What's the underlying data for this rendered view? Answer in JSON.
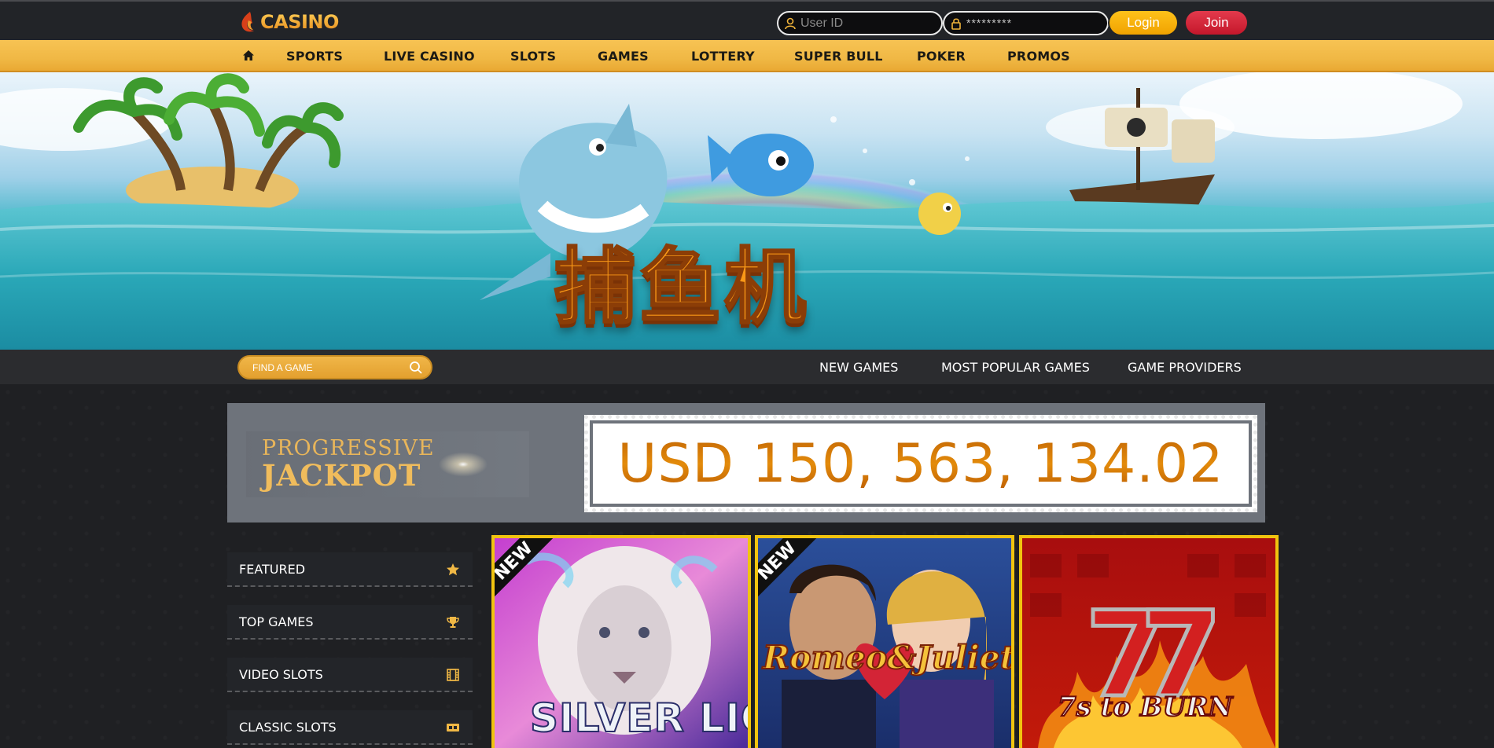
{
  "header": {
    "logo_text": "CASINO",
    "user_id_placeholder": "User ID",
    "password_placeholder": "*********",
    "login_label": "Login",
    "join_label": "Join"
  },
  "nav": {
    "items": [
      "SPORTS",
      "LIVE CASINO",
      "SLOTS",
      "GAMES",
      "LOTTERY",
      "SUPER BULL",
      "POKER",
      "PROMOS"
    ]
  },
  "banner": {
    "title": "捕鱼机"
  },
  "search": {
    "placeholder": "FIND A GAME"
  },
  "sublinks": [
    "NEW GAMES",
    "MOST POPULAR GAMES",
    "GAME PROVIDERS"
  ],
  "jackpot": {
    "line1": "PROGRESSIVE",
    "line2": "JACKPOT",
    "amount": "USD 150, 563, 134.02"
  },
  "categories": [
    {
      "label": "FEATURED",
      "icon": "star-icon"
    },
    {
      "label": "TOP GAMES",
      "icon": "trophy-icon"
    },
    {
      "label": "VIDEO SLOTS",
      "icon": "film-icon"
    },
    {
      "label": "CLASSIC SLOTS",
      "icon": "ticket-icon"
    }
  ],
  "games": [
    {
      "title": "SILVER LION",
      "badge": "NEW"
    },
    {
      "title": "Romeo&Juliet",
      "badge": "NEW"
    },
    {
      "title": "7s to BURN",
      "badge": ""
    }
  ],
  "colors": {
    "accent_yellow": "#f0b845",
    "login_button": "#ffc21a",
    "join_button": "#d42a3c",
    "jackpot_amount": "#d9790a",
    "tile_border": "#f1c40f"
  }
}
